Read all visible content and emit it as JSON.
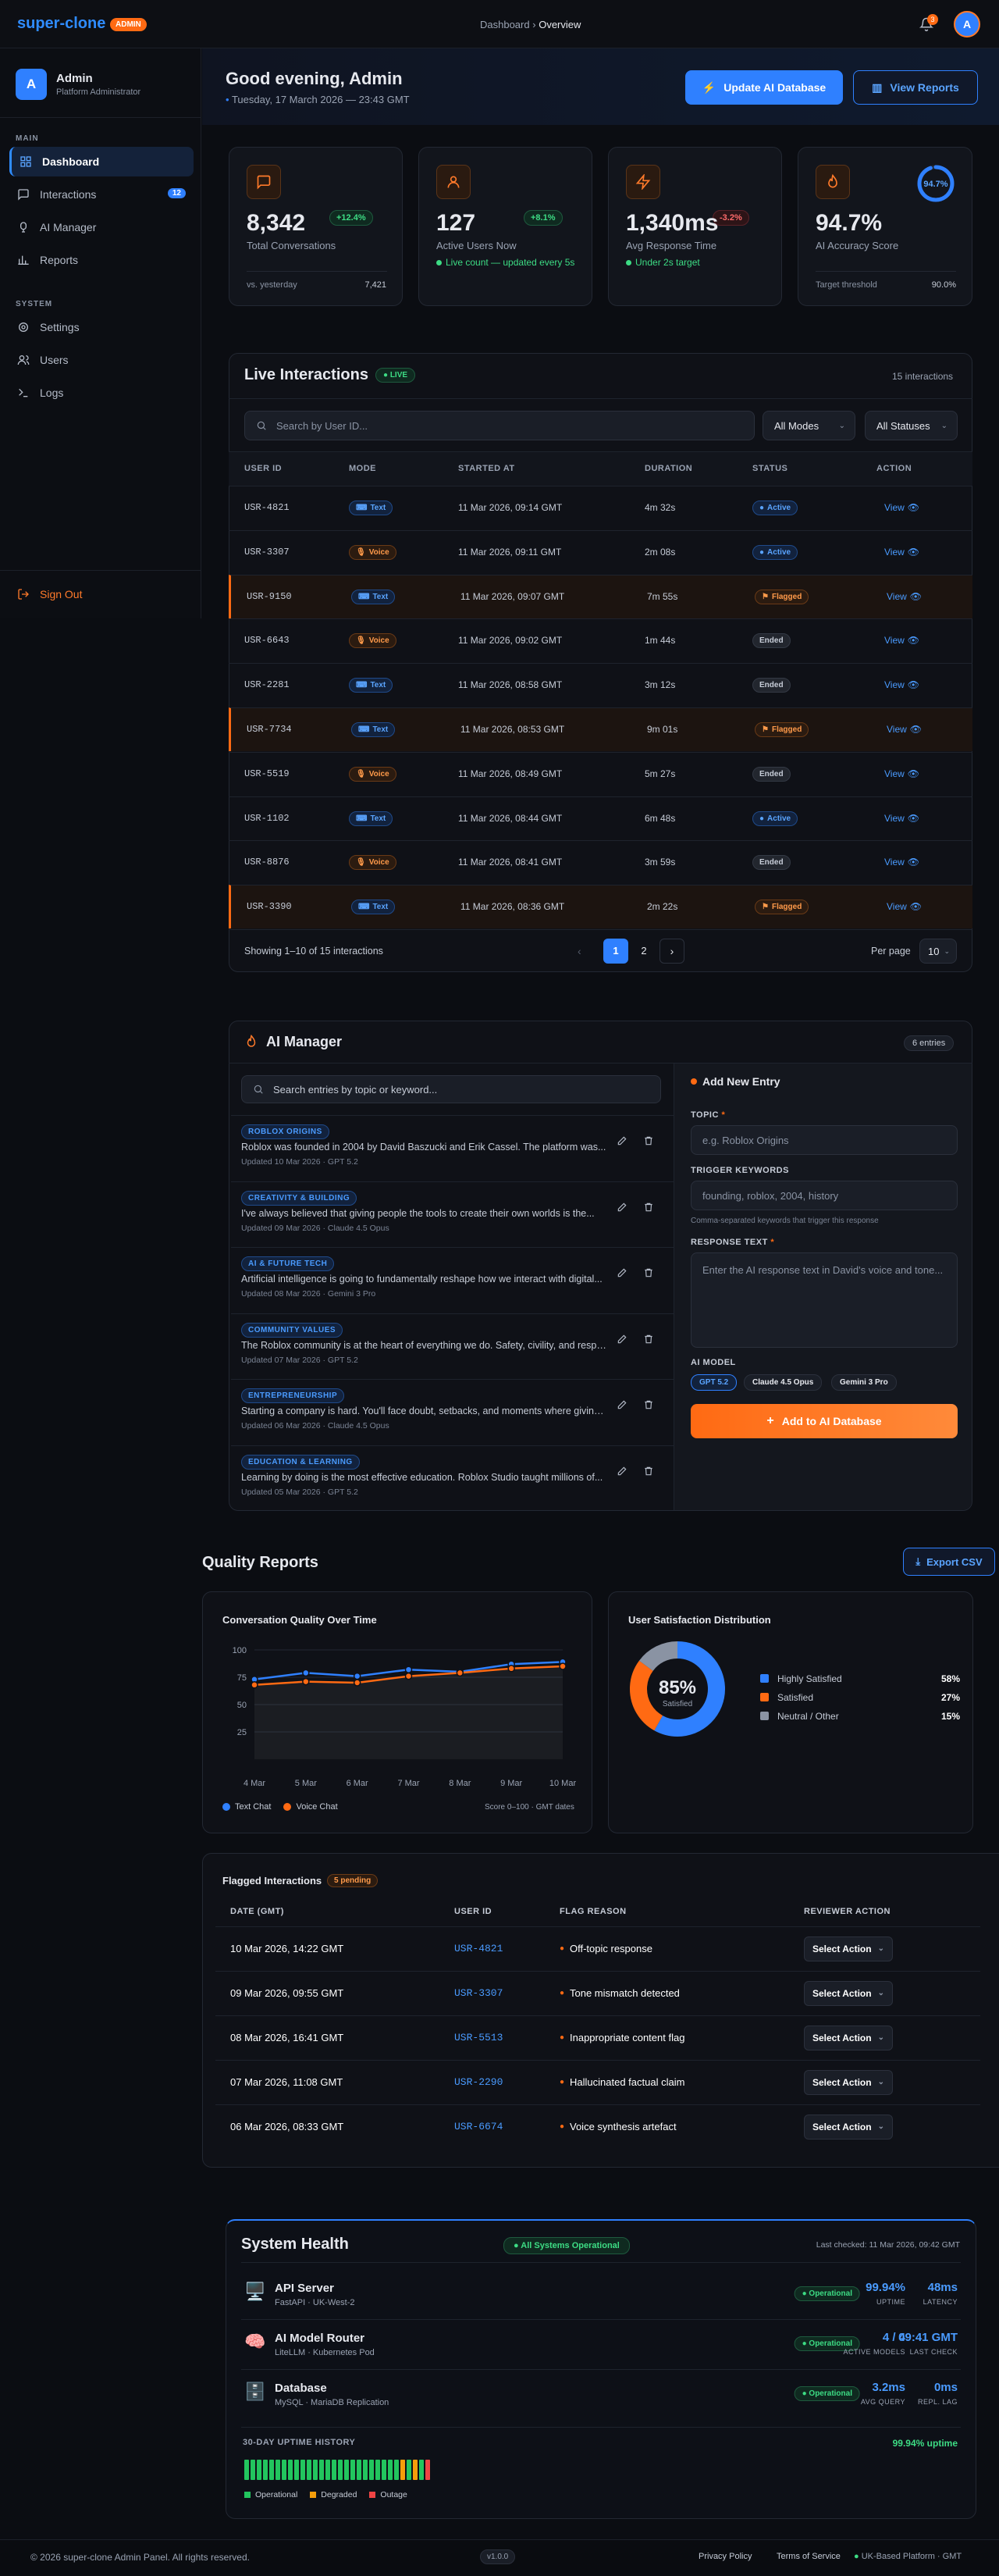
{
  "header": {
    "brand": "super-clone",
    "admin_badge": "ADMIN",
    "breadcrumb_root": "Dashboard",
    "breadcrumb_sep": "›",
    "breadcrumb_current": "Overview",
    "notification_count": "3",
    "avatar_initial": "A"
  },
  "sidebar": {
    "avatar_initial": "A",
    "name": "Admin",
    "role": "Platform Administrator",
    "main_label": "MAIN",
    "system_label": "SYSTEM",
    "items": [
      {
        "label": "Dashboard",
        "icon": "grid-icon"
      },
      {
        "label": "Interactions",
        "icon": "chat-icon",
        "count": "12"
      },
      {
        "label": "AI Manager",
        "icon": "brain-icon"
      },
      {
        "label": "Reports",
        "icon": "bar-chart-icon"
      },
      {
        "label": "Settings",
        "icon": "gear-icon"
      },
      {
        "label": "Users",
        "icon": "users-icon"
      },
      {
        "label": "Logs",
        "icon": "terminal-icon"
      }
    ],
    "sign_out": "Sign Out"
  },
  "welcome": {
    "greeting": "Good evening, Admin",
    "date": "Tuesday, 17 March 2026",
    "time_sep": "—",
    "time": "23:43 GMT",
    "update_button": "Update AI Database",
    "reports_button": "View Reports"
  },
  "stats": [
    {
      "value": "8,342",
      "label": "Total Conversations",
      "delta": "+12.4%",
      "footer_label": "vs. yesterday",
      "footer_value": "7,421"
    },
    {
      "value": "127",
      "label": "Active Users Now",
      "delta": "+8.1%",
      "note": "Live count — updated every 5s"
    },
    {
      "value": "1,340ms",
      "label": "Avg Response Time",
      "delta": "-3.2%",
      "note": "Under 2s target"
    },
    {
      "value": "94.7%",
      "label": "AI Accuracy Score",
      "ring": "94.7%",
      "ring_fraction": 0.947,
      "footer_label": "Target threshold",
      "footer_value": "90.0%"
    }
  ],
  "live": {
    "title": "Live Interactions",
    "live_badge": "LIVE",
    "count": "15 interactions",
    "search_placeholder": "Search by User ID...",
    "mode_filter": "All Modes",
    "status_filter": "All Statuses",
    "columns": [
      "USER ID",
      "MODE",
      "STARTED AT",
      "DURATION",
      "STATUS",
      "ACTION"
    ],
    "view_label": "View",
    "rows": [
      {
        "user": "USR-4821",
        "mode": "Text",
        "started": "11 Mar 2026, 09:14 GMT",
        "duration": "4m 32s",
        "status": "Active"
      },
      {
        "user": "USR-3307",
        "mode": "Voice",
        "started": "11 Mar 2026, 09:11 GMT",
        "duration": "2m 08s",
        "status": "Active"
      },
      {
        "user": "USR-9150",
        "mode": "Text",
        "started": "11 Mar 2026, 09:07 GMT",
        "duration": "7m 55s",
        "status": "Flagged"
      },
      {
        "user": "USR-6643",
        "mode": "Voice",
        "started": "11 Mar 2026, 09:02 GMT",
        "duration": "1m 44s",
        "status": "Ended"
      },
      {
        "user": "USR-2281",
        "mode": "Text",
        "started": "11 Mar 2026, 08:58 GMT",
        "duration": "3m 12s",
        "status": "Ended"
      },
      {
        "user": "USR-7734",
        "mode": "Text",
        "started": "11 Mar 2026, 08:53 GMT",
        "duration": "9m 01s",
        "status": "Flagged"
      },
      {
        "user": "USR-5519",
        "mode": "Voice",
        "started": "11 Mar 2026, 08:49 GMT",
        "duration": "5m 27s",
        "status": "Ended"
      },
      {
        "user": "USR-1102",
        "mode": "Text",
        "started": "11 Mar 2026, 08:44 GMT",
        "duration": "6m 48s",
        "status": "Active"
      },
      {
        "user": "USR-8876",
        "mode": "Voice",
        "started": "11 Mar 2026, 08:41 GMT",
        "duration": "3m 59s",
        "status": "Ended"
      },
      {
        "user": "USR-3390",
        "mode": "Text",
        "started": "11 Mar 2026, 08:36 GMT",
        "duration": "2m 22s",
        "status": "Flagged"
      }
    ],
    "showing": "Showing 1–10 of 15 interactions",
    "pages": [
      "1",
      "2"
    ],
    "per_page_label": "Per page",
    "per_page": "10"
  },
  "ai_manager": {
    "title": "AI Manager",
    "entries_count": "6 entries",
    "search_placeholder": "Search entries by topic or keyword...",
    "entries": [
      {
        "tag": "ROBLOX ORIGINS",
        "text": "Roblox was founded in 2004 by David Baszucki and Erik Cassel. The platform was...",
        "meta": "Updated 10 Mar 2026 · GPT 5.2"
      },
      {
        "tag": "CREATIVITY & BUILDING",
        "text": "I've always believed that giving people the tools to create their own worlds is the...",
        "meta": "Updated 09 Mar 2026 · Claude 4.5 Opus"
      },
      {
        "tag": "AI & FUTURE TECH",
        "text": "Artificial intelligence is going to fundamentally reshape how we interact with digital...",
        "meta": "Updated 08 Mar 2026 · Gemini 3 Pro"
      },
      {
        "tag": "COMMUNITY VALUES",
        "text": "The Roblox community is at the heart of everything we do. Safety, civility, and respect...",
        "meta": "Updated 07 Mar 2026 · GPT 5.2"
      },
      {
        "tag": "ENTREPRENEURSHIP",
        "text": "Starting a company is hard. You'll face doubt, setbacks, and moments where giving up...",
        "meta": "Updated 06 Mar 2026 · Claude 4.5 Opus"
      },
      {
        "tag": "EDUCATION & LEARNING",
        "text": "Learning by doing is the most effective education. Roblox Studio taught millions of...",
        "meta": "Updated 05 Mar 2026 · GPT 5.2"
      }
    ],
    "form": {
      "title": "Add New Entry",
      "topic_label": "TOPIC",
      "topic_placeholder": "e.g. Roblox Origins",
      "keywords_label": "TRIGGER KEYWORDS",
      "keywords_placeholder": "founding, roblox, 2004, history",
      "keywords_hint": "Comma-separated keywords that trigger this response",
      "response_label": "RESPONSE TEXT",
      "response_placeholder": "Enter the AI response text in David's voice and tone...",
      "model_label": "AI MODEL",
      "models": [
        "GPT 5.2",
        "Claude 4.5 Opus",
        "Gemini 3 Pro"
      ],
      "submit": "Add to AI Database"
    }
  },
  "quality": {
    "title": "Quality Reports",
    "export_button": "Export CSV"
  },
  "chart_data": [
    {
      "type": "line",
      "title": "Conversation Quality Over Time",
      "x": [
        "4 Mar",
        "5 Mar",
        "6 Mar",
        "7 Mar",
        "8 Mar",
        "9 Mar",
        "10 Mar"
      ],
      "yticks": [
        "100",
        "75",
        "50",
        "25"
      ],
      "ylim": [
        0,
        100
      ],
      "series": [
        {
          "name": "Text Chat",
          "color": "#2f80ff",
          "values": [
            73,
            79,
            76,
            82,
            80,
            87,
            89
          ]
        },
        {
          "name": "Voice Chat",
          "color": "#ff6a13",
          "values": [
            68,
            71,
            70,
            76,
            79,
            83,
            85
          ]
        }
      ],
      "note": "Score 0–100 · GMT dates"
    },
    {
      "type": "pie",
      "title": "User Satisfaction Distribution",
      "center_value": "85%",
      "center_label": "Satisfied",
      "slices": [
        {
          "name": "Highly Satisfied",
          "value": 58,
          "label": "58%",
          "color": "#2f80ff"
        },
        {
          "name": "Satisfied",
          "value": 27,
          "label": "27%",
          "color": "#ff6a13"
        },
        {
          "name": "Neutral / Other",
          "value": 15,
          "label": "15%",
          "color": "#8a93a3"
        }
      ]
    }
  ],
  "flagged": {
    "title": "Flagged Interactions",
    "pending": "5 pending",
    "columns": [
      "DATE (GMT)",
      "USER ID",
      "FLAG REASON",
      "REVIEWER ACTION"
    ],
    "action_label": "Select Action",
    "rows": [
      {
        "date": "10 Mar 2026, 14:22 GMT",
        "user": "USR-4821",
        "reason": "Off-topic response"
      },
      {
        "date": "09 Mar 2026, 09:55 GMT",
        "user": "USR-3307",
        "reason": "Tone mismatch detected"
      },
      {
        "date": "08 Mar 2026, 16:41 GMT",
        "user": "USR-5513",
        "reason": "Inappropriate content flag"
      },
      {
        "date": "07 Mar 2026, 11:08 GMT",
        "user": "USR-2290",
        "reason": "Hallucinated factual claim"
      },
      {
        "date": "06 Mar 2026, 08:33 GMT",
        "user": "USR-6674",
        "reason": "Voice synthesis artefact"
      }
    ]
  },
  "health": {
    "title": "System Health",
    "overall": "All Systems Operational",
    "last_checked": "Last checked: 11 Mar 2026, 09:42 GMT",
    "services": [
      {
        "icon": "server-icon",
        "name": "API Server",
        "sub": "FastAPI · UK-West-2",
        "status": "Operational",
        "m1": "99.94%",
        "m1_label": "UPTIME",
        "m2": "48ms",
        "m2_label": "LATENCY"
      },
      {
        "icon": "brain-icon",
        "name": "AI Model Router",
        "sub": "LiteLLM · Kubernetes Pod",
        "status": "Operational",
        "m1": "4 / 4",
        "m1_label": "ACTIVE MODELS",
        "m2": "09:41 GMT",
        "m2_label": "LAST CHECK"
      },
      {
        "icon": "database-icon",
        "name": "Database",
        "sub": "MySQL · MariaDB Replication",
        "status": "Operational",
        "m1": "3.2ms",
        "m1_label": "AVG QUERY",
        "m2": "0ms",
        "m2_label": "REPL. LAG"
      }
    ],
    "uptime_label": "30-DAY UPTIME HISTORY",
    "uptime_value": "99.94% uptime",
    "uptime_days": [
      "ok",
      "ok",
      "ok",
      "ok",
      "ok",
      "ok",
      "ok",
      "ok",
      "ok",
      "ok",
      "ok",
      "ok",
      "ok",
      "ok",
      "ok",
      "ok",
      "ok",
      "ok",
      "ok",
      "ok",
      "ok",
      "ok",
      "ok",
      "ok",
      "ok",
      "degraded",
      "ok",
      "degraded",
      "ok",
      "outage"
    ],
    "legend": [
      "Operational",
      "Degraded",
      "Outage"
    ]
  },
  "footer": {
    "copyright": "© 2026 super-clone Admin Panel. All rights reserved.",
    "version": "v1.0.0",
    "privacy": "Privacy Policy",
    "terms": "Terms of Service",
    "region": "UK-Based Platform · GMT"
  }
}
